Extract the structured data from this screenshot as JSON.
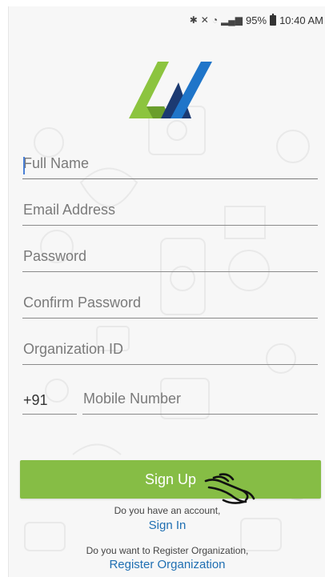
{
  "status_bar": {
    "icons": [
      "bluetooth-icon",
      "mute-icon",
      "wifi-icon",
      "signal-icon"
    ],
    "battery": "95%",
    "time": "10:40 AM"
  },
  "logo": {
    "name": "app-logo",
    "colors": {
      "green": "#8cc43f",
      "blue": "#1f75c9",
      "navy": "#1c3a72"
    }
  },
  "form": {
    "full_name_placeholder": "Full Name",
    "email_placeholder": "Email Address",
    "password_placeholder": "Password",
    "confirm_password_placeholder": "Confirm Password",
    "organization_id_placeholder": "Organization ID",
    "country_code": "+91",
    "mobile_placeholder": "Mobile Number"
  },
  "actions": {
    "signup_label": "Sign Up",
    "have_account_text": "Do you have an account,",
    "signin_label": "Sign In",
    "register_org_text": "Do you want to Register Organization,",
    "register_org_label": "Register Organization"
  },
  "colors": {
    "accent_green": "#86bd45",
    "link_blue": "#1f6fb2",
    "caret_blue": "#4a7fd6"
  }
}
